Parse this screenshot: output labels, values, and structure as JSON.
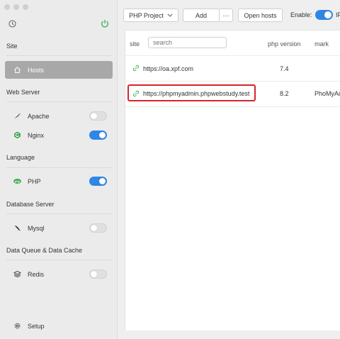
{
  "sidebar": {
    "sections": {
      "site": "Site",
      "web_server": "Web Server",
      "language": "Language",
      "database_server": "Database Server",
      "data_queue": "Data Queue & Data Cache"
    },
    "items": {
      "hosts": "Hosts",
      "apache": "Apache",
      "nginx": "Nginx",
      "php": "PHP",
      "mysql": "Mysql",
      "redis": "Redis",
      "setup": "Setup"
    },
    "toggles": {
      "apache": false,
      "nginx": true,
      "php": true,
      "mysql": false,
      "redis": false
    }
  },
  "toolbar": {
    "project_select": "PHP Project",
    "add_label": "Add",
    "more_label": "···",
    "open_hosts_label": "Open hosts",
    "enable_label": "Enable:",
    "truncated_label": "IP"
  },
  "table": {
    "headers": {
      "site": "site",
      "php_version": "php version",
      "mark": "mark"
    },
    "search_placeholder": "search",
    "rows": [
      {
        "site": "https://oa.xpf.com",
        "php_version": "7.4",
        "mark": ""
      },
      {
        "site": "https://phpmyadmin.phpwebstudy.test",
        "php_version": "8.2",
        "mark": "PhoMyAd"
      }
    ]
  },
  "colors": {
    "accent": "#2f86e4",
    "highlight": "#d8242a",
    "active_item": "#a8a8a8",
    "link_icon": "#3cae58"
  }
}
